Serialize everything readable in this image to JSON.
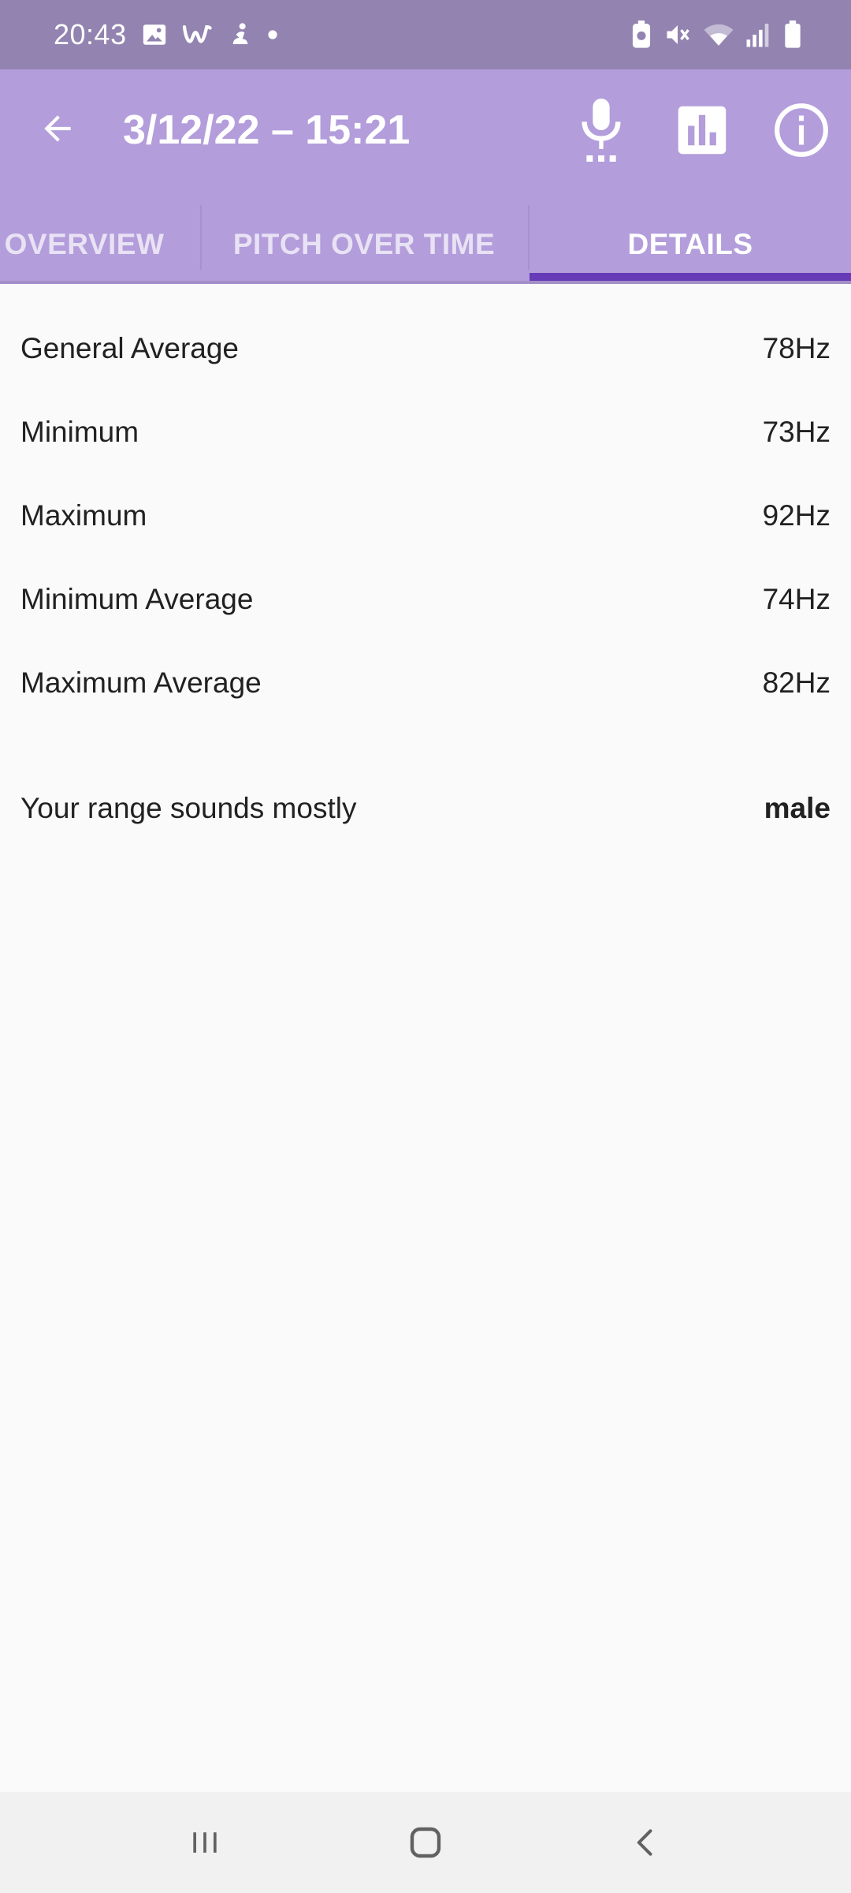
{
  "status_bar": {
    "time": "20:43",
    "left_icons": [
      "gallery-icon",
      "app-w-icon",
      "app-figure-icon",
      "dot-icon"
    ],
    "right_icons": [
      "battery-saver-icon",
      "mute-icon",
      "wifi-icon",
      "signal-icon",
      "battery-icon"
    ]
  },
  "app_bar": {
    "title": "3/12/22 – 15:21",
    "back_icon": "arrow-left-icon",
    "actions": [
      "microphone-icon",
      "bar-chart-icon",
      "info-icon"
    ]
  },
  "tabs": [
    {
      "label": "OVERVIEW",
      "selected": false
    },
    {
      "label": "PITCH OVER TIME",
      "selected": false
    },
    {
      "label": "DETAILS",
      "selected": true
    }
  ],
  "details": {
    "rows": [
      {
        "label": "General Average",
        "value": "78Hz"
      },
      {
        "label": "Minimum",
        "value": "73Hz"
      },
      {
        "label": "Maximum",
        "value": "92Hz"
      },
      {
        "label": "Minimum Average",
        "value": "74Hz"
      },
      {
        "label": "Maximum Average",
        "value": "82Hz"
      }
    ],
    "verdict": {
      "label": "Your range sounds mostly",
      "value": "male"
    }
  },
  "colors": {
    "status_bar": "#9283b0",
    "app_bar": "#b39ddb",
    "tab_indicator": "#673ab7",
    "background": "#fafafa",
    "nav_bar": "#f1f1f1"
  },
  "nav_bar": [
    "recent-apps-icon",
    "home-icon",
    "back-icon"
  ]
}
